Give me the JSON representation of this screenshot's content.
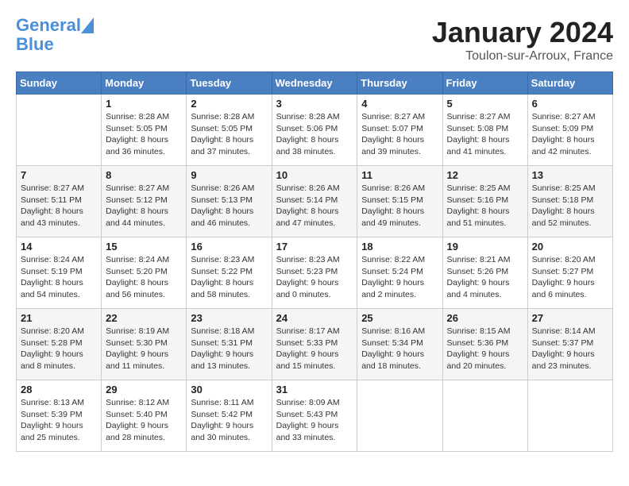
{
  "logo": {
    "line1": "General",
    "line2": "Blue"
  },
  "title": "January 2024",
  "location": "Toulon-sur-Arroux, France",
  "weekdays": [
    "Sunday",
    "Monday",
    "Tuesday",
    "Wednesday",
    "Thursday",
    "Friday",
    "Saturday"
  ],
  "weeks": [
    [
      {
        "day": "",
        "info": ""
      },
      {
        "day": "1",
        "info": "Sunrise: 8:28 AM\nSunset: 5:05 PM\nDaylight: 8 hours\nand 36 minutes."
      },
      {
        "day": "2",
        "info": "Sunrise: 8:28 AM\nSunset: 5:05 PM\nDaylight: 8 hours\nand 37 minutes."
      },
      {
        "day": "3",
        "info": "Sunrise: 8:28 AM\nSunset: 5:06 PM\nDaylight: 8 hours\nand 38 minutes."
      },
      {
        "day": "4",
        "info": "Sunrise: 8:27 AM\nSunset: 5:07 PM\nDaylight: 8 hours\nand 39 minutes."
      },
      {
        "day": "5",
        "info": "Sunrise: 8:27 AM\nSunset: 5:08 PM\nDaylight: 8 hours\nand 41 minutes."
      },
      {
        "day": "6",
        "info": "Sunrise: 8:27 AM\nSunset: 5:09 PM\nDaylight: 8 hours\nand 42 minutes."
      }
    ],
    [
      {
        "day": "7",
        "info": "Sunrise: 8:27 AM\nSunset: 5:11 PM\nDaylight: 8 hours\nand 43 minutes."
      },
      {
        "day": "8",
        "info": "Sunrise: 8:27 AM\nSunset: 5:12 PM\nDaylight: 8 hours\nand 44 minutes."
      },
      {
        "day": "9",
        "info": "Sunrise: 8:26 AM\nSunset: 5:13 PM\nDaylight: 8 hours\nand 46 minutes."
      },
      {
        "day": "10",
        "info": "Sunrise: 8:26 AM\nSunset: 5:14 PM\nDaylight: 8 hours\nand 47 minutes."
      },
      {
        "day": "11",
        "info": "Sunrise: 8:26 AM\nSunset: 5:15 PM\nDaylight: 8 hours\nand 49 minutes."
      },
      {
        "day": "12",
        "info": "Sunrise: 8:25 AM\nSunset: 5:16 PM\nDaylight: 8 hours\nand 51 minutes."
      },
      {
        "day": "13",
        "info": "Sunrise: 8:25 AM\nSunset: 5:18 PM\nDaylight: 8 hours\nand 52 minutes."
      }
    ],
    [
      {
        "day": "14",
        "info": "Sunrise: 8:24 AM\nSunset: 5:19 PM\nDaylight: 8 hours\nand 54 minutes."
      },
      {
        "day": "15",
        "info": "Sunrise: 8:24 AM\nSunset: 5:20 PM\nDaylight: 8 hours\nand 56 minutes."
      },
      {
        "day": "16",
        "info": "Sunrise: 8:23 AM\nSunset: 5:22 PM\nDaylight: 8 hours\nand 58 minutes."
      },
      {
        "day": "17",
        "info": "Sunrise: 8:23 AM\nSunset: 5:23 PM\nDaylight: 9 hours\nand 0 minutes."
      },
      {
        "day": "18",
        "info": "Sunrise: 8:22 AM\nSunset: 5:24 PM\nDaylight: 9 hours\nand 2 minutes."
      },
      {
        "day": "19",
        "info": "Sunrise: 8:21 AM\nSunset: 5:26 PM\nDaylight: 9 hours\nand 4 minutes."
      },
      {
        "day": "20",
        "info": "Sunrise: 8:20 AM\nSunset: 5:27 PM\nDaylight: 9 hours\nand 6 minutes."
      }
    ],
    [
      {
        "day": "21",
        "info": "Sunrise: 8:20 AM\nSunset: 5:28 PM\nDaylight: 9 hours\nand 8 minutes."
      },
      {
        "day": "22",
        "info": "Sunrise: 8:19 AM\nSunset: 5:30 PM\nDaylight: 9 hours\nand 11 minutes."
      },
      {
        "day": "23",
        "info": "Sunrise: 8:18 AM\nSunset: 5:31 PM\nDaylight: 9 hours\nand 13 minutes."
      },
      {
        "day": "24",
        "info": "Sunrise: 8:17 AM\nSunset: 5:33 PM\nDaylight: 9 hours\nand 15 minutes."
      },
      {
        "day": "25",
        "info": "Sunrise: 8:16 AM\nSunset: 5:34 PM\nDaylight: 9 hours\nand 18 minutes."
      },
      {
        "day": "26",
        "info": "Sunrise: 8:15 AM\nSunset: 5:36 PM\nDaylight: 9 hours\nand 20 minutes."
      },
      {
        "day": "27",
        "info": "Sunrise: 8:14 AM\nSunset: 5:37 PM\nDaylight: 9 hours\nand 23 minutes."
      }
    ],
    [
      {
        "day": "28",
        "info": "Sunrise: 8:13 AM\nSunset: 5:39 PM\nDaylight: 9 hours\nand 25 minutes."
      },
      {
        "day": "29",
        "info": "Sunrise: 8:12 AM\nSunset: 5:40 PM\nDaylight: 9 hours\nand 28 minutes."
      },
      {
        "day": "30",
        "info": "Sunrise: 8:11 AM\nSunset: 5:42 PM\nDaylight: 9 hours\nand 30 minutes."
      },
      {
        "day": "31",
        "info": "Sunrise: 8:09 AM\nSunset: 5:43 PM\nDaylight: 9 hours\nand 33 minutes."
      },
      {
        "day": "",
        "info": ""
      },
      {
        "day": "",
        "info": ""
      },
      {
        "day": "",
        "info": ""
      }
    ]
  ]
}
